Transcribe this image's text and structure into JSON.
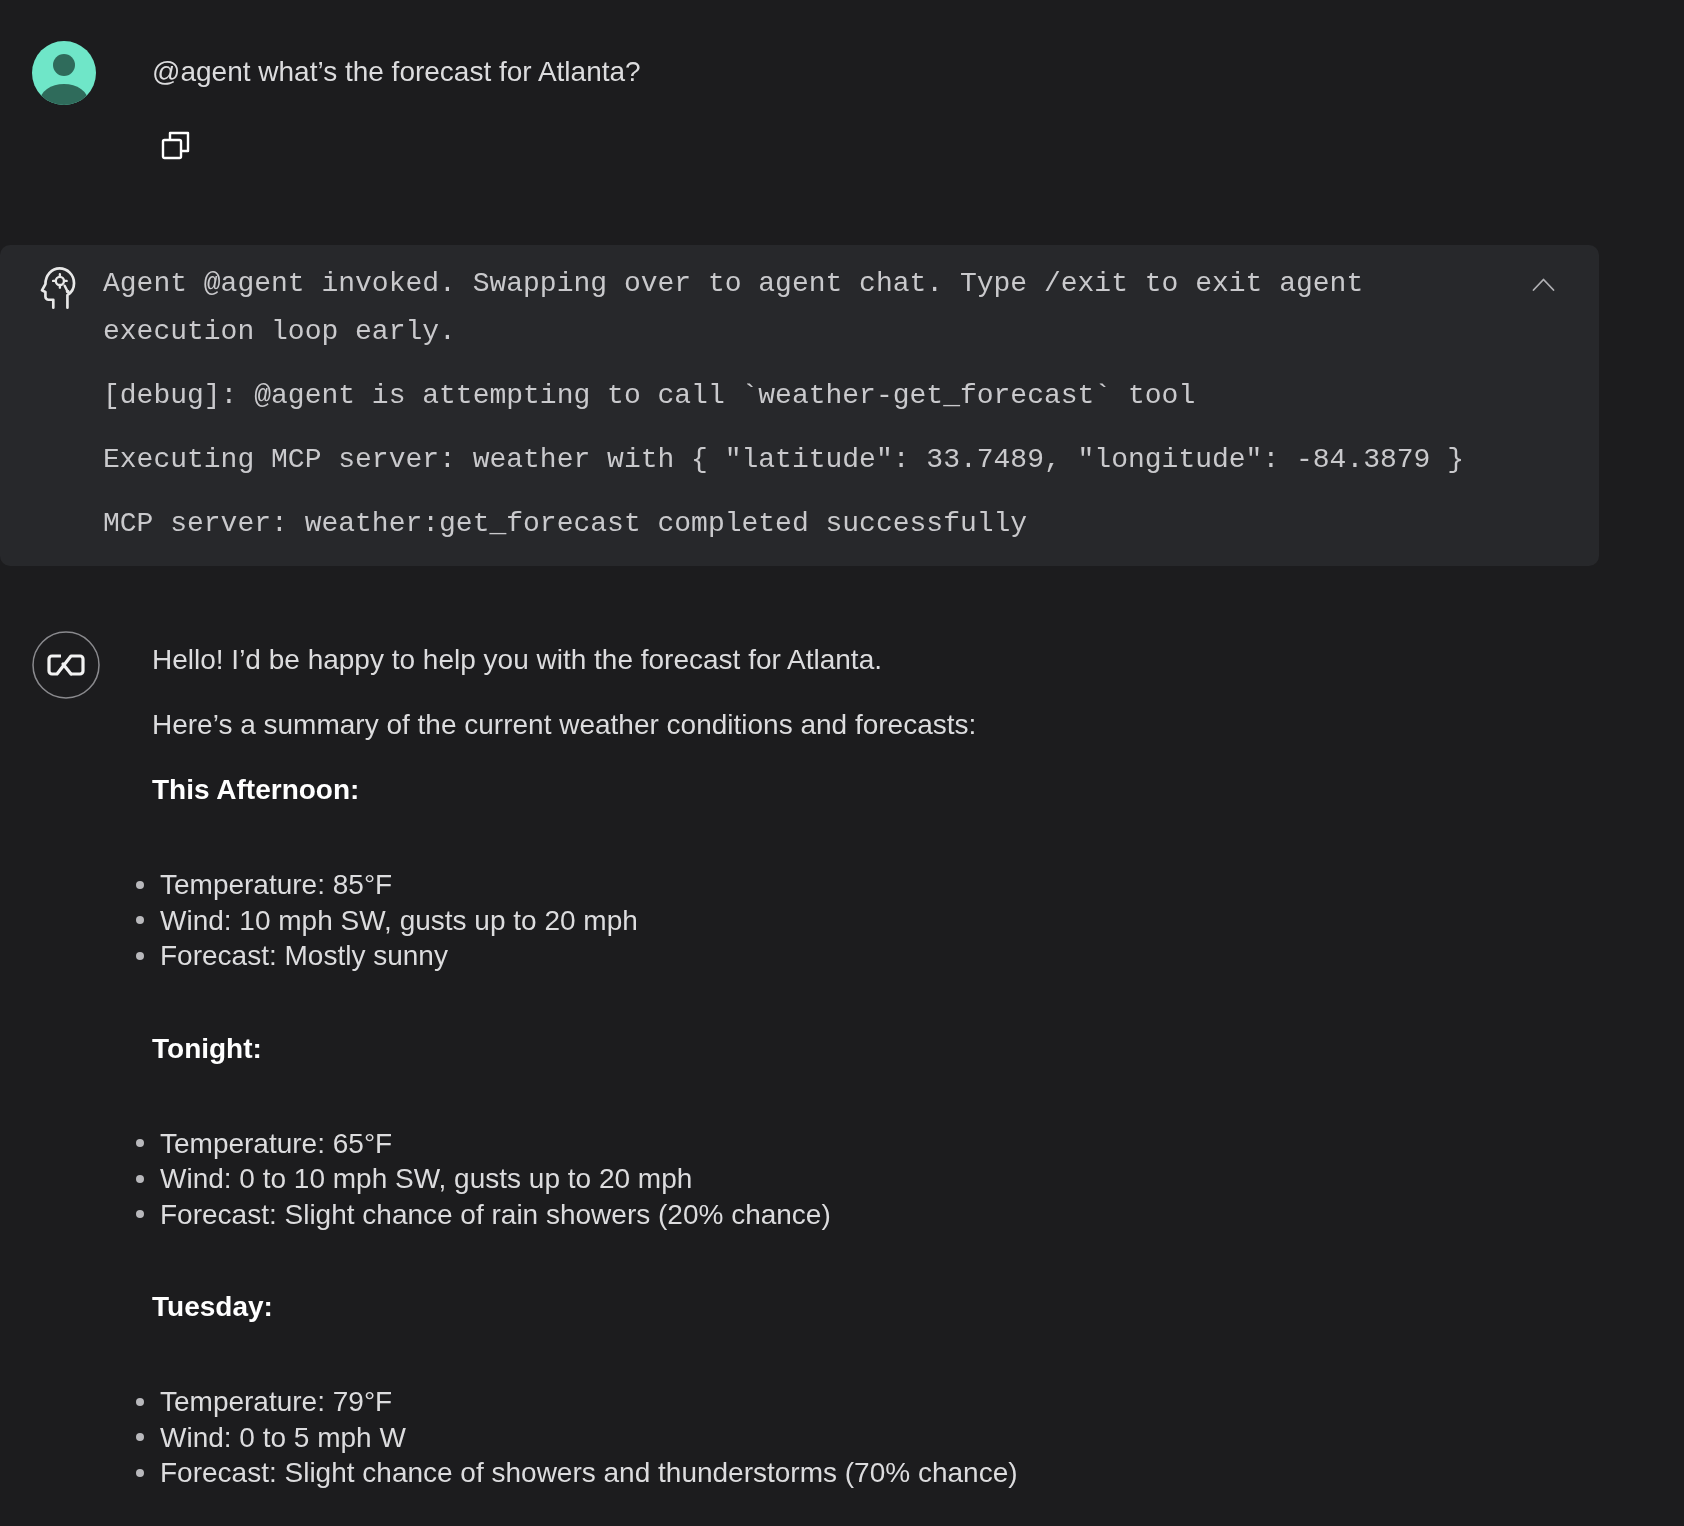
{
  "user_message": {
    "text": "@agent what’s the forecast for Atlanta?"
  },
  "agent_log": {
    "expanded": true,
    "lines": [
      "Agent @agent invoked. Swapping over to agent chat. Type /exit to exit agent execution loop early.",
      "[debug]: @agent is attempting to call `weather-get_forecast` tool",
      "Executing MCP server: weather with { \"latitude\": 33.7489, \"longitude\": -84.3879 }",
      "MCP server: weather:get_forecast completed successfully"
    ]
  },
  "assistant_message": {
    "paragraphs": [
      "Hello! I’d be happy to help you with the forecast for Atlanta.",
      "Here’s a summary of the current weather conditions and forecasts:"
    ],
    "sections": [
      {
        "heading": "This Afternoon:",
        "items": [
          "Temperature: 85°F",
          "Wind: 10 mph SW, gusts up to 20 mph",
          "Forecast: Mostly sunny"
        ]
      },
      {
        "heading": "Tonight:",
        "items": [
          "Temperature: 65°F",
          "Wind: 0 to 10 mph SW, gusts up to 20 mph",
          "Forecast: Slight chance of rain showers (20% chance)"
        ]
      },
      {
        "heading": "Tuesday:",
        "items": [
          "Temperature: 79°F",
          "Wind: 0 to 5 mph W",
          "Forecast: Slight chance of showers and thunderstorms (70% chance)"
        ]
      }
    ]
  }
}
